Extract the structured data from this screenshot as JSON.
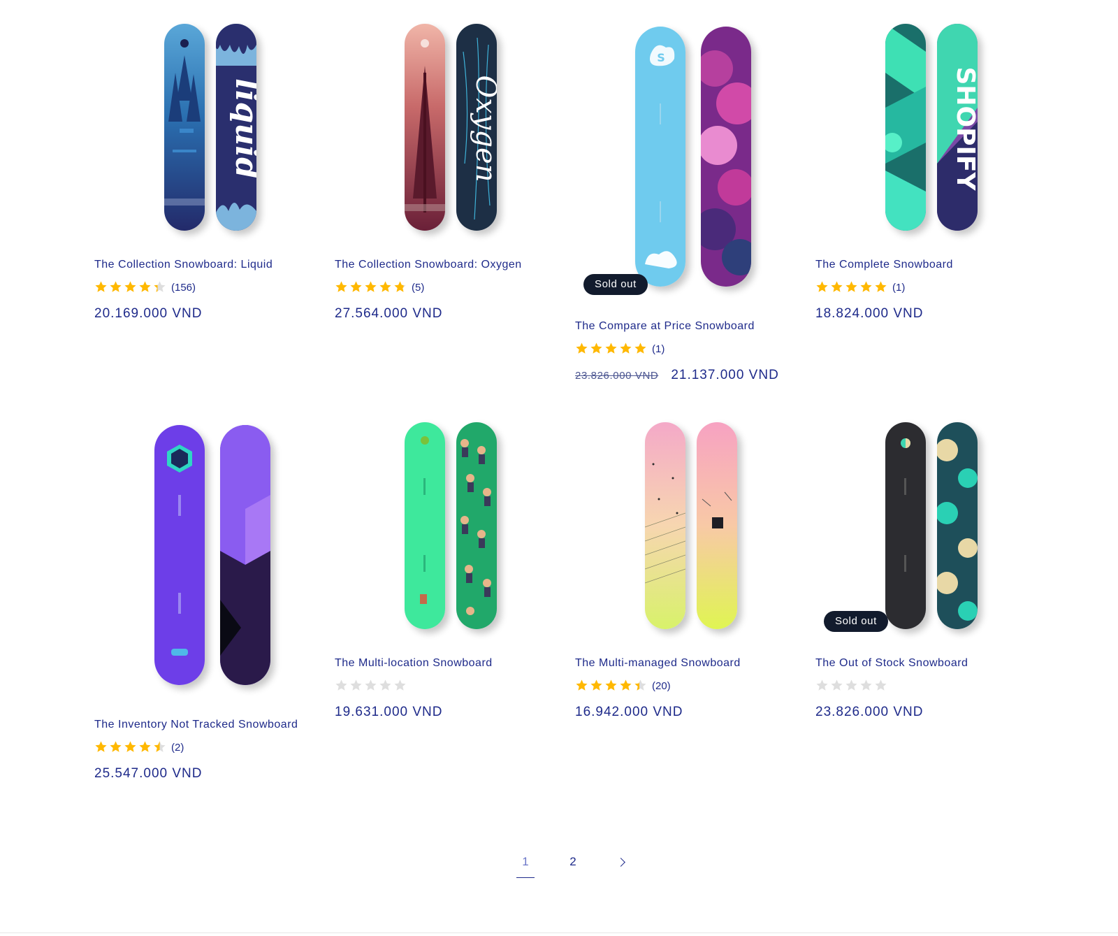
{
  "colors": {
    "link": "#1e2a8a",
    "star": "#ffb800",
    "star_empty": "#dedede",
    "badge_bg": "#121b2d"
  },
  "products": [
    {
      "title": "The Collection Snowboard: Liquid",
      "rating": 4.3,
      "review_count": "(156)",
      "price": "20.169.000 VND"
    },
    {
      "title": "The Collection Snowboard: Oxygen",
      "rating": 4.8,
      "review_count": "(5)",
      "price": "27.564.000 VND"
    },
    {
      "title": "The Compare at Price Snowboard",
      "rating": 5,
      "review_count": "(1)",
      "compare_price": "23.826.000 VND",
      "price": "21.137.000 VND",
      "badge": "Sold out"
    },
    {
      "title": "The Complete Snowboard",
      "rating": 5,
      "review_count": "(1)",
      "price": "18.824.000 VND"
    },
    {
      "title": "The Inventory Not Tracked Snowboard",
      "rating": 4.5,
      "review_count": "(2)",
      "price": "25.547.000 VND"
    },
    {
      "title": "The Multi-location Snowboard",
      "rating": 0,
      "review_count": "",
      "price": "19.631.000 VND"
    },
    {
      "title": "The Multi-managed Snowboard",
      "rating": 4.4,
      "review_count": "(20)",
      "price": "16.942.000 VND"
    },
    {
      "title": "The Out of Stock Snowboard",
      "rating": 0,
      "review_count": "",
      "price": "23.826.000 VND",
      "badge": "Sold out"
    }
  ],
  "board_art_text": {
    "liquid": "liquid",
    "oxygen": "Oxygen",
    "shopify": "SHOPIFY"
  },
  "pagination": {
    "pages": [
      "1",
      "2"
    ],
    "current": "1",
    "next_icon": "chevron-right-icon"
  }
}
